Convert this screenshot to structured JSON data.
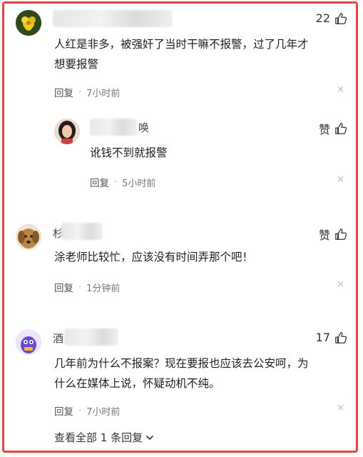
{
  "comments": [
    {
      "name_suffix": "",
      "likes": "22",
      "text_lines": [
        "人红是非多，被强奸了当时干嘛不报警，过了几年才",
        "想要报警"
      ],
      "reply_label": "回复",
      "time": "7小时前"
    },
    {
      "name_suffix": "唤",
      "likes": "赞",
      "text_lines": [
        "讹钱不到就报警"
      ],
      "reply_label": "回复",
      "time": "5小时前"
    },
    {
      "name_suffix": "杉",
      "likes": "赞",
      "text_lines": [
        "涂老师比较忙，应该没有时间弄那个吧！"
      ],
      "reply_label": "回复",
      "time": "1分钟前"
    },
    {
      "name_suffix": "酒",
      "likes": "17",
      "text_lines": [
        "几年前为什么不报案？现在要报也应该去公安呵，为",
        "什么在媒体上说，怀疑动机不纯。"
      ],
      "reply_label": "回复",
      "time": "7小时前"
    }
  ],
  "view_all": "查看全部 1 条回复",
  "close_glyph": "×",
  "separator": "·"
}
